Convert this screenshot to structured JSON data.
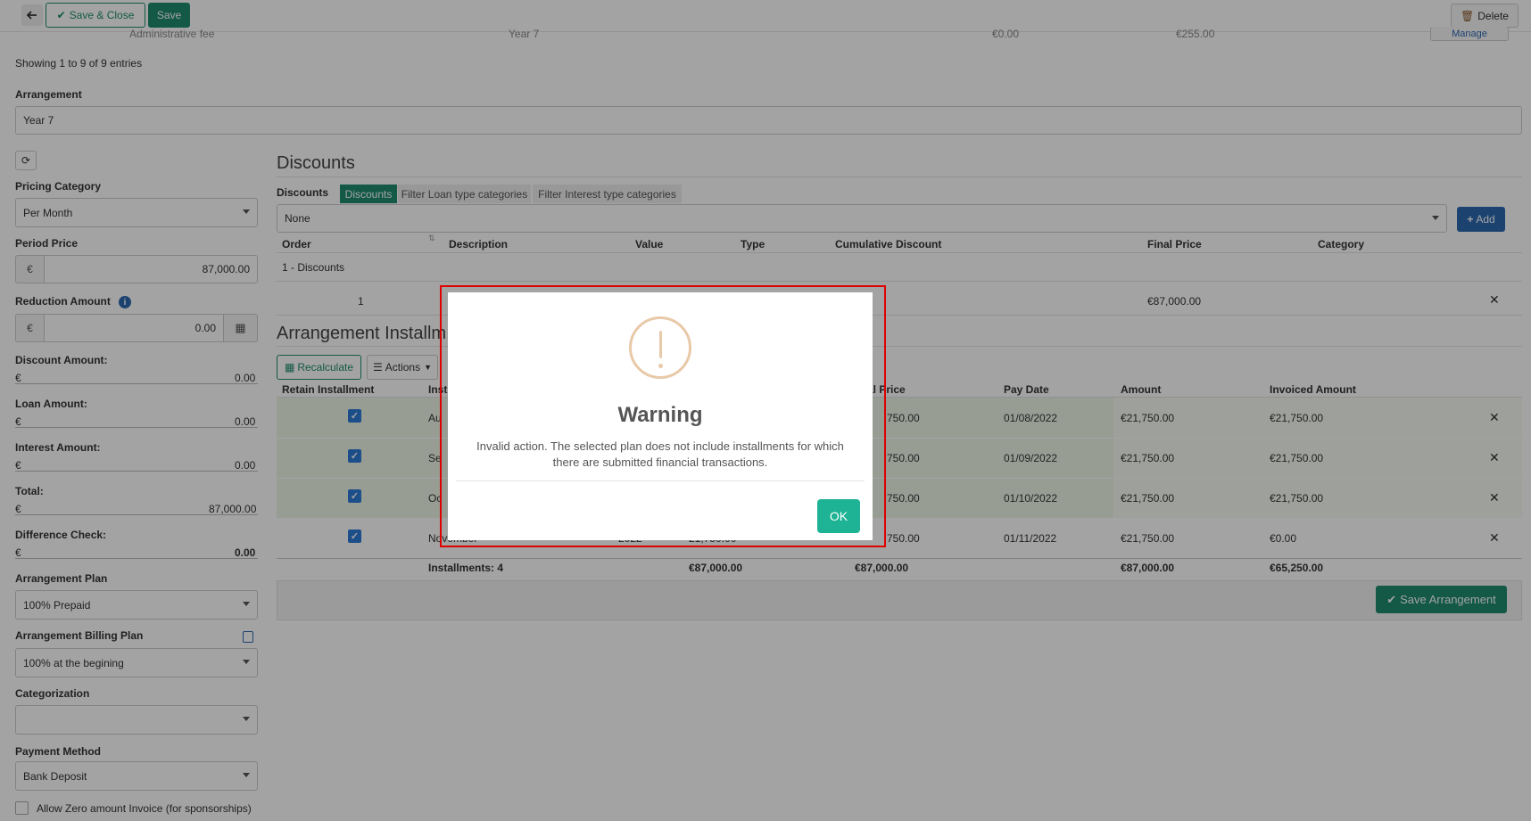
{
  "toolbar": {
    "back_icon": "arrow-left-icon",
    "save_close_label": "Save & Close",
    "save_label": "Save",
    "delete_label": "Delete"
  },
  "top_table": {
    "partial_row": {
      "description": "Administrative fee",
      "arrangement": "Year 7",
      "col3": "€0.00",
      "col4": "€255.00",
      "manage_label": "Manage"
    },
    "info": "Showing 1 to 9 of 9 entries"
  },
  "arrangement": {
    "label": "Arrangement",
    "value": "Year 7"
  },
  "left_form": {
    "pricing_category": {
      "label": "Pricing Category",
      "value": "Per Month"
    },
    "period_price": {
      "label": "Period Price",
      "currency": "€",
      "value": "87,000.00"
    },
    "reduction_amount": {
      "label": "Reduction Amount",
      "currency": "€",
      "value": "0.00"
    },
    "discount_amount": {
      "label": "Discount Amount:",
      "currency": "€",
      "value": "0.00"
    },
    "loan_amount": {
      "label": "Loan Amount:",
      "currency": "€",
      "value": "0.00"
    },
    "interest_amount": {
      "label": "Interest Amount:",
      "currency": "€",
      "value": "0.00"
    },
    "total": {
      "label": "Total:",
      "currency": "€",
      "value": "87,000.00"
    },
    "difference_check": {
      "label": "Difference Check:",
      "currency": "€",
      "value": "0.00"
    },
    "arrangement_plan": {
      "label": "Arrangement Plan",
      "value": "100% Prepaid"
    },
    "billing_plan": {
      "label": "Arrangement Billing Plan",
      "value": "100% at the begining"
    },
    "categorization": {
      "label": "Categorization",
      "value": ""
    },
    "payment_method": {
      "label": "Payment Method",
      "value": "Bank Deposit"
    },
    "allow_zero": {
      "label": "Allow Zero amount Invoice (for sponsorships)"
    }
  },
  "discounts": {
    "title": "Discounts",
    "label": "Discounts",
    "tabs": [
      "Discounts",
      "Filter Loan type categories",
      "Filter Interest type categories"
    ],
    "select_value": "None",
    "add_label": "Add",
    "columns": [
      "Order",
      "Description",
      "Value",
      "Type",
      "Cumulative Discount",
      "Final Price",
      "Category"
    ],
    "group": "1 - Discounts",
    "rows": [
      {
        "order": "1",
        "final_price": "€87,000.00"
      }
    ]
  },
  "installments": {
    "title": "Arrangement Installm",
    "recalculate_label": "Recalculate",
    "actions_label": "Actions",
    "columns": [
      "Retain Installment",
      "Inst",
      "al Price",
      "Pay Date",
      "Amount",
      "Invoiced Amount"
    ],
    "rows": [
      {
        "name": "Au",
        "final_price": "750.00",
        "pay_date": "01/08/2022",
        "amount": "€21,750.00",
        "invoiced": "€21,750.00"
      },
      {
        "name": "Se",
        "final_price": "750.00",
        "pay_date": "01/09/2022",
        "amount": "€21,750.00",
        "invoiced": "€21,750.00"
      },
      {
        "name": "Oc",
        "final_price": "750.00",
        "pay_date": "01/10/2022",
        "amount": "€21,750.00",
        "invoiced": "€21,750.00"
      },
      {
        "name": "November",
        "year": "2022",
        "price": "21,750.00",
        "final_price": "750.00",
        "pay_date": "01/11/2022",
        "amount": "€21,750.00",
        "invoiced": "€0.00"
      }
    ],
    "footer": {
      "count": "Installments: 4",
      "price": "€87,000.00",
      "final_price": "€87,000.00",
      "amount": "€87,000.00",
      "invoiced": "€65,250.00"
    },
    "save_label": "Save Arrangement"
  },
  "modal": {
    "icon": "exclamation-circle-icon",
    "title": "Warning",
    "message_line1": "Invalid action. The selected plan does not include installments for which",
    "message_line2": "there are submitted financial transactions.",
    "ok_label": "OK"
  },
  "colors": {
    "green": "#1e8c6e",
    "blue": "#2c6ab0",
    "checkbox": "#2d7bd8",
    "ok": "#1db394",
    "warning_icon": "#e8c9a8",
    "highlight": "#e00000"
  }
}
